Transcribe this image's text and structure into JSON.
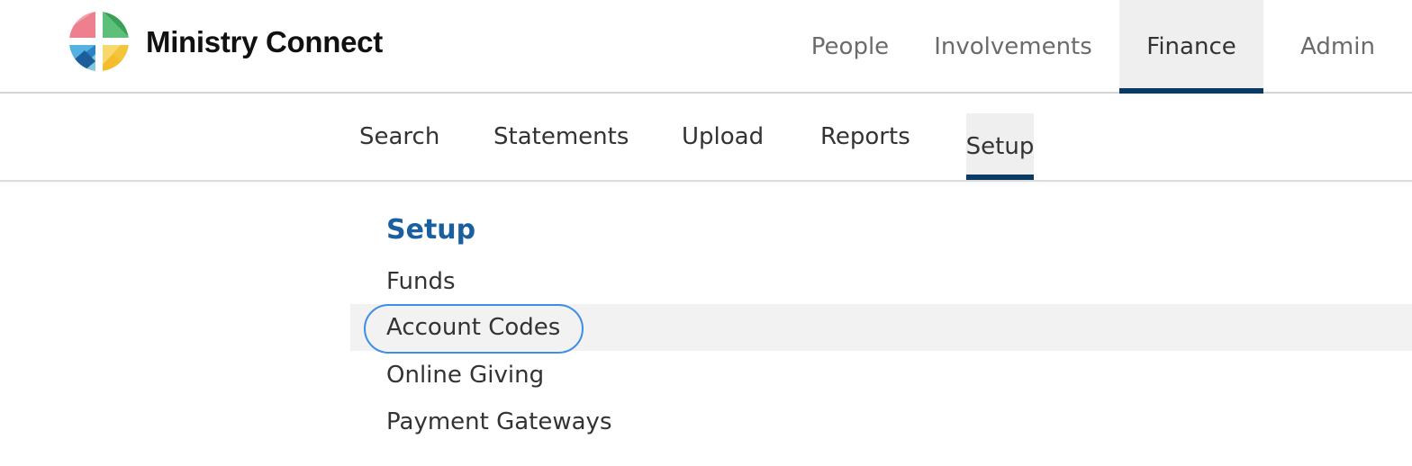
{
  "app": {
    "name": "Ministry Connect"
  },
  "top_nav": {
    "items": [
      {
        "label": "People"
      },
      {
        "label": "Involvements"
      },
      {
        "label": "Finance",
        "active": true
      },
      {
        "label": "Admin"
      }
    ]
  },
  "sub_nav": {
    "items": [
      {
        "label": "Search"
      },
      {
        "label": "Statements"
      },
      {
        "label": "Upload"
      },
      {
        "label": "Reports"
      },
      {
        "label": "Setup",
        "active": true
      }
    ]
  },
  "setup": {
    "title": "Setup",
    "items": [
      {
        "label": "Funds"
      },
      {
        "label": "Account Codes",
        "active": true
      },
      {
        "label": "Online Giving"
      },
      {
        "label": "Payment Gateways"
      }
    ]
  },
  "colors": {
    "accent": "#0b3a66",
    "title": "#1a5fa0",
    "focus": "#3d8ee6"
  }
}
